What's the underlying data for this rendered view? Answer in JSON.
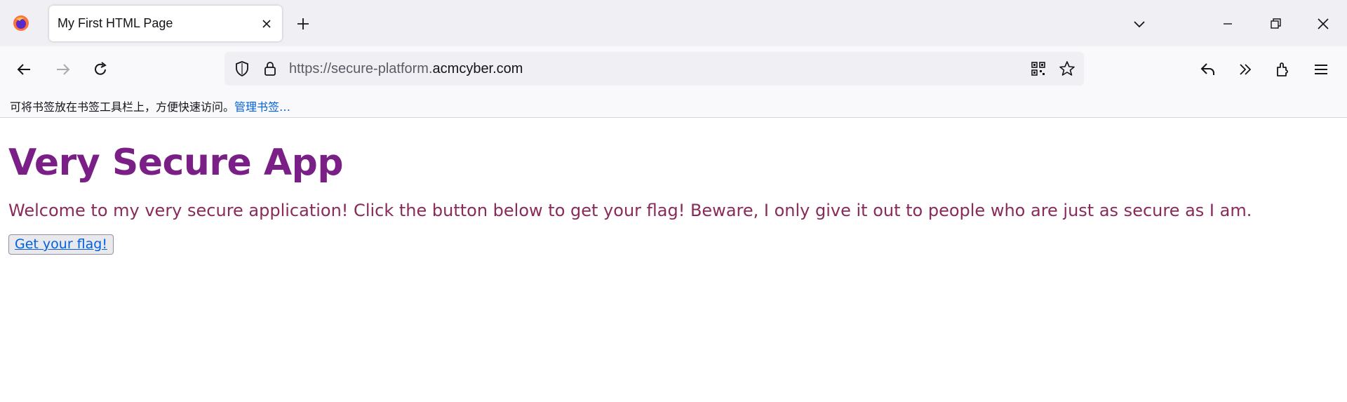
{
  "browser": {
    "tab_title": "My First HTML Page",
    "url_prefix": "https://secure-platform.",
    "url_domain": "acmcyber.com",
    "bookmarks_hint": "可将书签放在书签工具栏上，方便快速访问。",
    "bookmarks_manage": "管理书签…"
  },
  "page": {
    "heading": "Very Secure App",
    "intro": "Welcome to my very secure application! Click the button below to get your flag! Beware, I only give it out to people who are just as secure as I am.",
    "button_label": "Get your flag!"
  },
  "colors": {
    "heading": "#7a1f86",
    "intro_text": "#8a2a5a",
    "link": "#0061e0"
  }
}
